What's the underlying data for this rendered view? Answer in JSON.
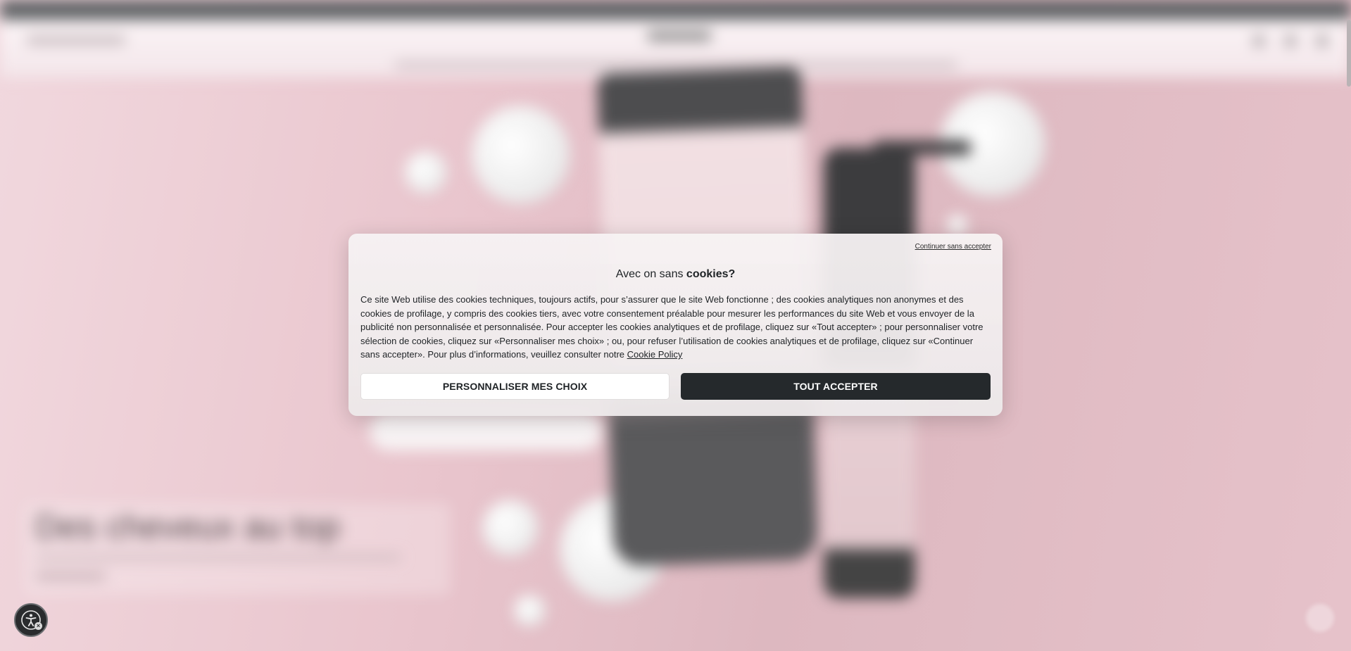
{
  "background_page": {
    "hero_title": "Des cheveux au top"
  },
  "cookie_banner": {
    "skip_link": "Continuer sans accepter",
    "title_prefix": "Avec on sans ",
    "title_bold": "cookies?",
    "body_text": "Ce site Web utilise des cookies techniques, toujours actifs, pour s’assurer que le site Web fonctionne ; des cookies analytiques non anonymes et des cookies de profilage, y compris des cookies tiers, avec votre consentement préalable pour mesurer les performances du site Web et vous envoyer de la publicité non personnalisée et personnalisée. Pour accepter les cookies analytiques et de profilage, cliquez sur «Tout accepter» ; pour personnaliser votre sélection de cookies, cliquez sur «Personnaliser mes choix» ; ou, pour refuser l’utilisation de cookies analytiques et de profilage, cliquez sur «Continuer sans accepter». Pour plus d’informations, veuillez consulter notre ",
    "policy_link": "Cookie Policy",
    "customize_button": "PERSONNALISER MES CHOIX",
    "accept_button": "TOUT ACCEPTER"
  },
  "icons": {
    "accessibility": "accessibility-icon"
  },
  "colors": {
    "accept_button_bg": "#25292c",
    "background_pink": "#e6c4cb",
    "modal_bg": "#f2eeef"
  }
}
